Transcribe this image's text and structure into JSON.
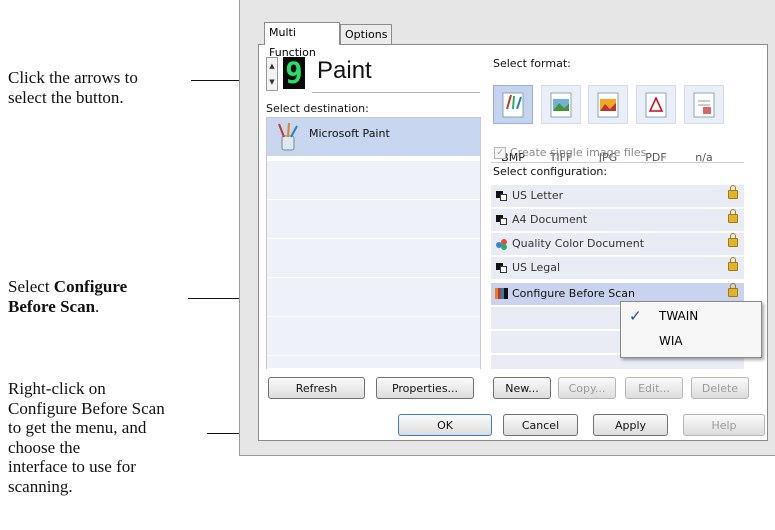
{
  "annotations": {
    "arrows_line1": "Click the arrows to",
    "arrows_line2": "select the button.",
    "config_line1": "Select ",
    "config_bold1": "Configure",
    "config_bold2": "Before Scan",
    "config_tail": ".",
    "rc_line1": "Right-click on",
    "rc_line2": "Configure Before Scan",
    "rc_line3": "to get the menu, and",
    "rc_line4": "choose the",
    "rc_line5": "interface to use for",
    "rc_line6": "scanning."
  },
  "tabs": {
    "multi": "Multi Function",
    "options": "Options"
  },
  "button_selector": {
    "number": "9",
    "name": "Paint"
  },
  "destination": {
    "label": "Select destination:",
    "items": [
      "Microsoft Paint"
    ]
  },
  "format": {
    "label": "Select format:",
    "items": [
      "BMP",
      "TIFF",
      "JPG",
      "PDF",
      "n/a"
    ],
    "selected": "BMP",
    "single_files": "Create single image files"
  },
  "configuration": {
    "label": "Select configuration:",
    "items": [
      "US Letter",
      "A4 Document",
      "Quality Color Document",
      "US Legal",
      "Configure Before Scan"
    ],
    "selected": "Configure Before Scan"
  },
  "context_menu": {
    "items": [
      "TWAIN",
      "WIA"
    ],
    "checked": "TWAIN",
    "check_mark": "✓"
  },
  "buttons": {
    "refresh": "Refresh",
    "properties": "Properties...",
    "new": "New...",
    "copy": "Copy...",
    "edit": "Edit...",
    "delete": "Delete",
    "ok": "OK",
    "cancel": "Cancel",
    "apply": "Apply",
    "help": "Help"
  },
  "colors": {
    "selected_row": "#c9d6f0",
    "segment_digit": "#22e06a",
    "lock": "#e2b22a"
  }
}
